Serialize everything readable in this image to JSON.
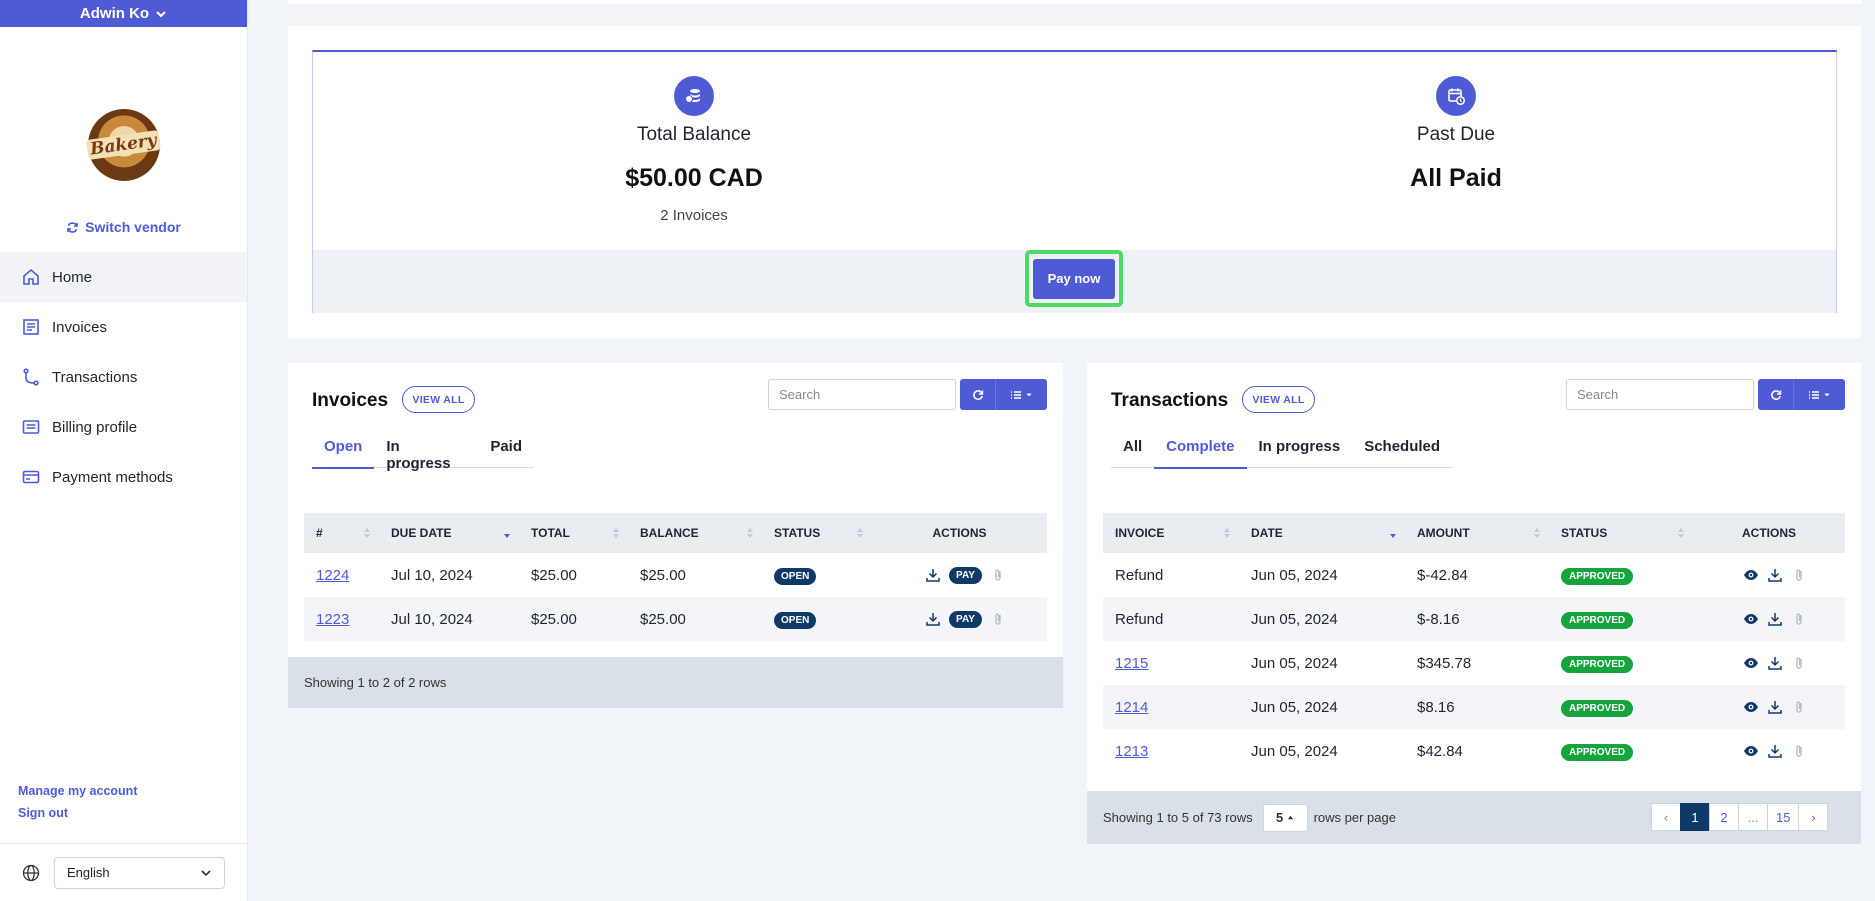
{
  "user": {
    "name": "Adwin Ko"
  },
  "vendor": {
    "logo_text": "Bakery",
    "switch_label": "Switch vendor"
  },
  "nav": [
    {
      "label": "Home",
      "active": true
    },
    {
      "label": "Invoices"
    },
    {
      "label": "Transactions"
    },
    {
      "label": "Billing profile"
    },
    {
      "label": "Payment methods"
    }
  ],
  "account": {
    "manage_label": "Manage my account",
    "signout_label": "Sign out"
  },
  "language": {
    "selected": "English"
  },
  "balance": {
    "total_title": "Total Balance",
    "total_amount": "$50.00 CAD",
    "total_sub": "2 Invoices",
    "pastdue_title": "Past Due",
    "pastdue_value": "All Paid",
    "pay_label": "Pay now"
  },
  "invoices": {
    "title": "Invoices",
    "view_all": "VIEW ALL",
    "search_placeholder": "Search",
    "tabs": [
      "Open",
      "In progress",
      "Paid"
    ],
    "columns": [
      "#",
      "DUE DATE",
      "TOTAL",
      "BALANCE",
      "STATUS",
      "ACTIONS"
    ],
    "rows": [
      {
        "num": "1224",
        "due": "Jul 10, 2024",
        "total": "$25.00",
        "balance": "$25.00",
        "status": "OPEN",
        "pay": "PAY"
      },
      {
        "num": "1223",
        "due": "Jul 10, 2024",
        "total": "$25.00",
        "balance": "$25.00",
        "status": "OPEN",
        "pay": "PAY"
      }
    ],
    "footer": "Showing 1 to 2 of 2 rows"
  },
  "transactions": {
    "title": "Transactions",
    "view_all": "VIEW ALL",
    "search_placeholder": "Search",
    "tabs": [
      "All",
      "Complete",
      "In progress",
      "Scheduled"
    ],
    "columns": [
      "INVOICE",
      "DATE",
      "AMOUNT",
      "STATUS",
      "ACTIONS"
    ],
    "rows": [
      {
        "invoice": "Refund",
        "date": "Jun 05, 2024",
        "amount": "$-42.84",
        "status": "APPROVED"
      },
      {
        "invoice": "Refund",
        "date": "Jun 05, 2024",
        "amount": "$-8.16",
        "status": "APPROVED"
      },
      {
        "invoice": "1215",
        "date": "Jun 05, 2024",
        "amount": "$345.78",
        "status": "APPROVED"
      },
      {
        "invoice": "1214",
        "date": "Jun 05, 2024",
        "amount": "$8.16",
        "status": "APPROVED"
      },
      {
        "invoice": "1213",
        "date": "Jun 05, 2024",
        "amount": "$42.84",
        "status": "APPROVED"
      }
    ],
    "footer_prefix": "Showing 1 to 5 of 73 rows",
    "per_page": "5",
    "footer_suffix": "rows per page",
    "pages": [
      "‹",
      "1",
      "2",
      "...",
      "15",
      "›"
    ]
  },
  "colors": {
    "accent": "#4f5bd5",
    "navy": "#0f3a68",
    "approved": "#17a33d",
    "highlight": "#4cd964"
  }
}
